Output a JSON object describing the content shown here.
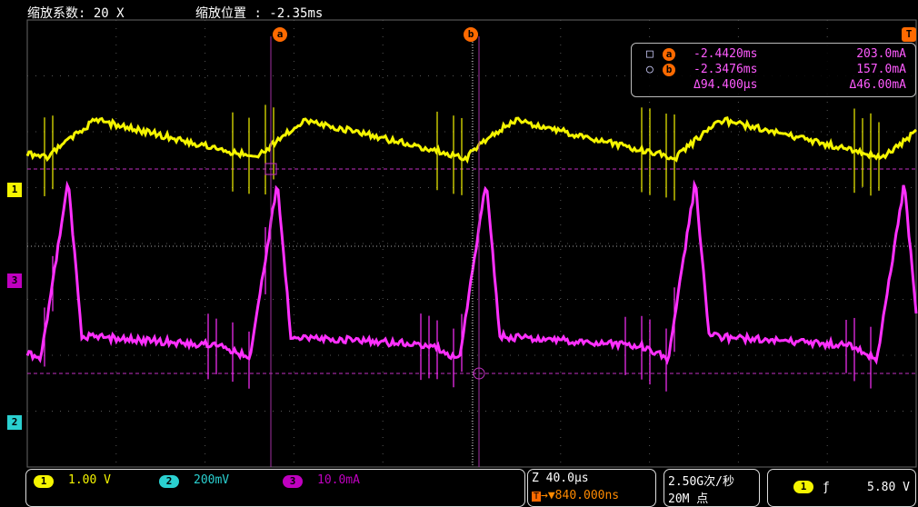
{
  "header": {
    "zoom_factor": "缩放系数: 20 X",
    "zoom_position": "缩放位置 : -2.35ms"
  },
  "cursors": {
    "a_label": "a",
    "b_label": "b",
    "rows": [
      {
        "symbol": "□",
        "badge": "a",
        "time": "-2.4420ms",
        "value": "203.0mA"
      },
      {
        "symbol": "○",
        "badge": "b",
        "time": "-2.3476ms",
        "value": "157.0mA"
      },
      {
        "symbol": "",
        "badge": "",
        "time": "Δ94.400µs",
        "value": "Δ46.00mA"
      }
    ]
  },
  "left_markers": [
    {
      "label": "1",
      "color": "#f5f500"
    },
    {
      "label": "3",
      "color": "#c000c0"
    },
    {
      "label": "2",
      "color": "#2ad0d0"
    }
  ],
  "trigger_marker": "T",
  "channels": [
    {
      "num": "1",
      "scale": "1.00 V",
      "color": "#f5f500"
    },
    {
      "num": "2",
      "scale": "200mV",
      "color": "#2ad0d0"
    },
    {
      "num": "3",
      "scale": "10.0mA",
      "color": "#c000c0"
    }
  ],
  "timebase": {
    "zoom": "Z 40.0µs",
    "trigger_pos": "▼840.000ns"
  },
  "acquisition": {
    "rate": "2.50G次/秒",
    "points": "20M 点"
  },
  "trigger": {
    "channel": "1",
    "slope": "ƒ",
    "level": "5.80 V"
  },
  "colors": {
    "yellow": "#f5f500",
    "magenta": "#ff30ff",
    "cursor": "#c030c0",
    "accent": "#ff6a00"
  }
}
